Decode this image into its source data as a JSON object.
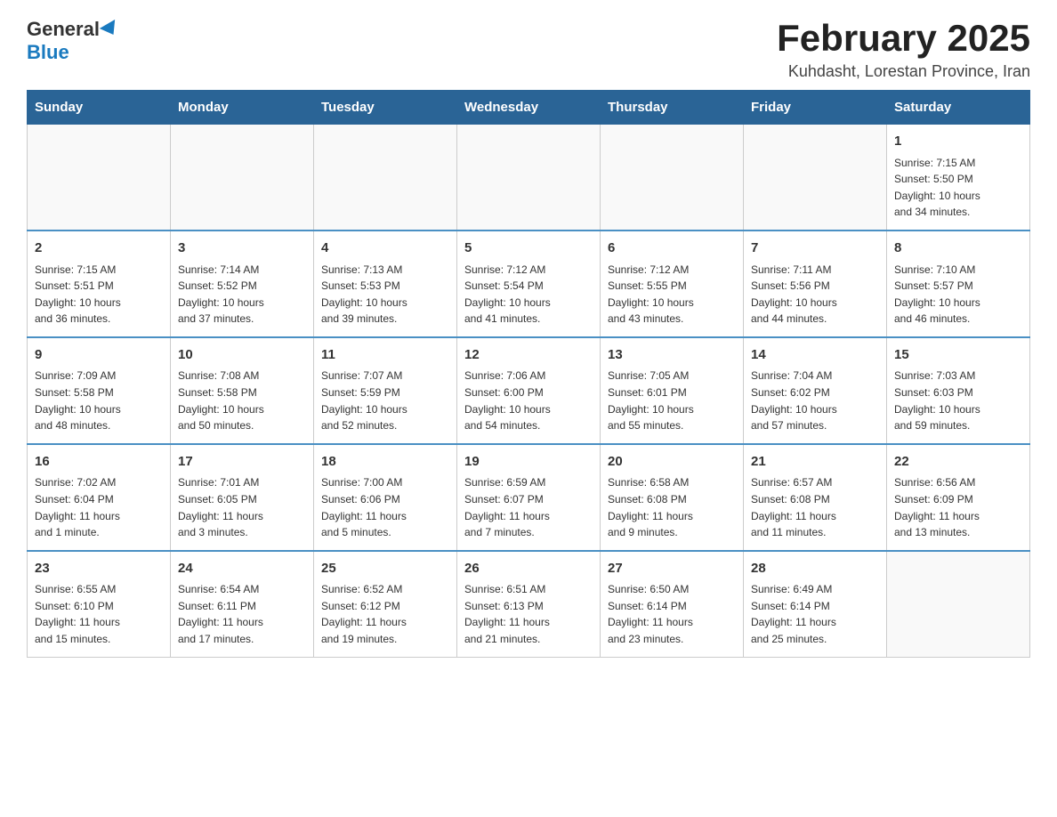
{
  "logo": {
    "general": "General",
    "blue": "Blue"
  },
  "header": {
    "title": "February 2025",
    "location": "Kuhdasht, Lorestan Province, Iran"
  },
  "days_of_week": [
    "Sunday",
    "Monday",
    "Tuesday",
    "Wednesday",
    "Thursday",
    "Friday",
    "Saturday"
  ],
  "weeks": [
    [
      {
        "day": "",
        "info": ""
      },
      {
        "day": "",
        "info": ""
      },
      {
        "day": "",
        "info": ""
      },
      {
        "day": "",
        "info": ""
      },
      {
        "day": "",
        "info": ""
      },
      {
        "day": "",
        "info": ""
      },
      {
        "day": "1",
        "info": "Sunrise: 7:15 AM\nSunset: 5:50 PM\nDaylight: 10 hours\nand 34 minutes."
      }
    ],
    [
      {
        "day": "2",
        "info": "Sunrise: 7:15 AM\nSunset: 5:51 PM\nDaylight: 10 hours\nand 36 minutes."
      },
      {
        "day": "3",
        "info": "Sunrise: 7:14 AM\nSunset: 5:52 PM\nDaylight: 10 hours\nand 37 minutes."
      },
      {
        "day": "4",
        "info": "Sunrise: 7:13 AM\nSunset: 5:53 PM\nDaylight: 10 hours\nand 39 minutes."
      },
      {
        "day": "5",
        "info": "Sunrise: 7:12 AM\nSunset: 5:54 PM\nDaylight: 10 hours\nand 41 minutes."
      },
      {
        "day": "6",
        "info": "Sunrise: 7:12 AM\nSunset: 5:55 PM\nDaylight: 10 hours\nand 43 minutes."
      },
      {
        "day": "7",
        "info": "Sunrise: 7:11 AM\nSunset: 5:56 PM\nDaylight: 10 hours\nand 44 minutes."
      },
      {
        "day": "8",
        "info": "Sunrise: 7:10 AM\nSunset: 5:57 PM\nDaylight: 10 hours\nand 46 minutes."
      }
    ],
    [
      {
        "day": "9",
        "info": "Sunrise: 7:09 AM\nSunset: 5:58 PM\nDaylight: 10 hours\nand 48 minutes."
      },
      {
        "day": "10",
        "info": "Sunrise: 7:08 AM\nSunset: 5:58 PM\nDaylight: 10 hours\nand 50 minutes."
      },
      {
        "day": "11",
        "info": "Sunrise: 7:07 AM\nSunset: 5:59 PM\nDaylight: 10 hours\nand 52 minutes."
      },
      {
        "day": "12",
        "info": "Sunrise: 7:06 AM\nSunset: 6:00 PM\nDaylight: 10 hours\nand 54 minutes."
      },
      {
        "day": "13",
        "info": "Sunrise: 7:05 AM\nSunset: 6:01 PM\nDaylight: 10 hours\nand 55 minutes."
      },
      {
        "day": "14",
        "info": "Sunrise: 7:04 AM\nSunset: 6:02 PM\nDaylight: 10 hours\nand 57 minutes."
      },
      {
        "day": "15",
        "info": "Sunrise: 7:03 AM\nSunset: 6:03 PM\nDaylight: 10 hours\nand 59 minutes."
      }
    ],
    [
      {
        "day": "16",
        "info": "Sunrise: 7:02 AM\nSunset: 6:04 PM\nDaylight: 11 hours\nand 1 minute."
      },
      {
        "day": "17",
        "info": "Sunrise: 7:01 AM\nSunset: 6:05 PM\nDaylight: 11 hours\nand 3 minutes."
      },
      {
        "day": "18",
        "info": "Sunrise: 7:00 AM\nSunset: 6:06 PM\nDaylight: 11 hours\nand 5 minutes."
      },
      {
        "day": "19",
        "info": "Sunrise: 6:59 AM\nSunset: 6:07 PM\nDaylight: 11 hours\nand 7 minutes."
      },
      {
        "day": "20",
        "info": "Sunrise: 6:58 AM\nSunset: 6:08 PM\nDaylight: 11 hours\nand 9 minutes."
      },
      {
        "day": "21",
        "info": "Sunrise: 6:57 AM\nSunset: 6:08 PM\nDaylight: 11 hours\nand 11 minutes."
      },
      {
        "day": "22",
        "info": "Sunrise: 6:56 AM\nSunset: 6:09 PM\nDaylight: 11 hours\nand 13 minutes."
      }
    ],
    [
      {
        "day": "23",
        "info": "Sunrise: 6:55 AM\nSunset: 6:10 PM\nDaylight: 11 hours\nand 15 minutes."
      },
      {
        "day": "24",
        "info": "Sunrise: 6:54 AM\nSunset: 6:11 PM\nDaylight: 11 hours\nand 17 minutes."
      },
      {
        "day": "25",
        "info": "Sunrise: 6:52 AM\nSunset: 6:12 PM\nDaylight: 11 hours\nand 19 minutes."
      },
      {
        "day": "26",
        "info": "Sunrise: 6:51 AM\nSunset: 6:13 PM\nDaylight: 11 hours\nand 21 minutes."
      },
      {
        "day": "27",
        "info": "Sunrise: 6:50 AM\nSunset: 6:14 PM\nDaylight: 11 hours\nand 23 minutes."
      },
      {
        "day": "28",
        "info": "Sunrise: 6:49 AM\nSunset: 6:14 PM\nDaylight: 11 hours\nand 25 minutes."
      },
      {
        "day": "",
        "info": ""
      }
    ]
  ]
}
